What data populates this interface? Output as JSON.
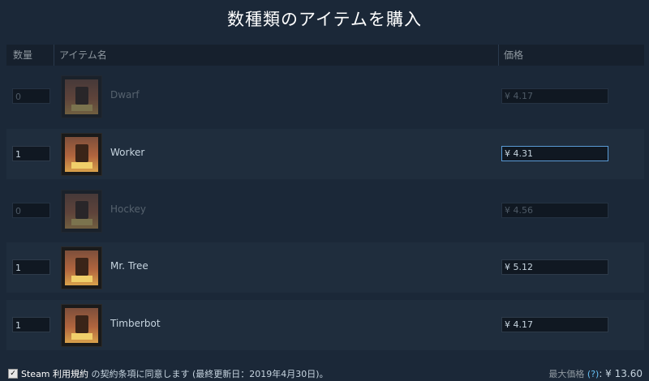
{
  "title": "数種類のアイテムを購入",
  "columns": {
    "quantity": "数量",
    "item_name": "アイテム名",
    "price": "価格"
  },
  "items": [
    {
      "quantity": "0",
      "name": "Dwarf",
      "price": "¥ 4.17",
      "enabled": false
    },
    {
      "quantity": "1",
      "name": "Worker",
      "price": "¥ 4.31",
      "enabled": true,
      "focused": true
    },
    {
      "quantity": "0",
      "name": "Hockey",
      "price": "¥ 4.56",
      "enabled": false
    },
    {
      "quantity": "1",
      "name": "Mr. Tree",
      "price": "¥ 5.12",
      "enabled": true
    },
    {
      "quantity": "1",
      "name": "Timberbot",
      "price": "¥ 4.17",
      "enabled": true
    }
  ],
  "footer": {
    "checkbox_checked": true,
    "checkbox_mark": "✓",
    "terms_link": "Steam 利用規約",
    "terms_text": " の契約条項に同意します (最終更新日：2019年4月30日)。",
    "max_label": "最大価格",
    "help": "(?)",
    "max_value": ": ¥ 13.60"
  }
}
